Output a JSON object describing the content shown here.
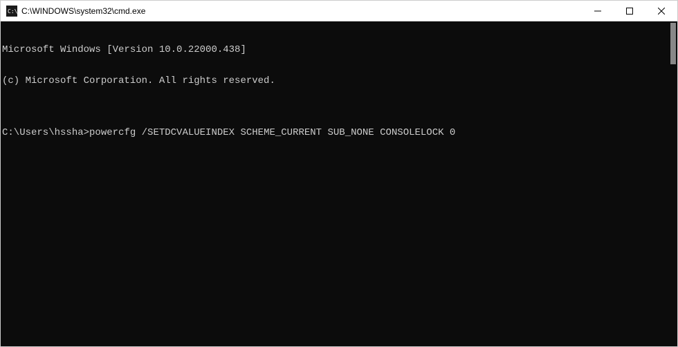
{
  "window": {
    "title": "C:\\WINDOWS\\system32\\cmd.exe"
  },
  "terminal": {
    "line1": "Microsoft Windows [Version 10.0.22000.438]",
    "line2": "(c) Microsoft Corporation. All rights reserved.",
    "blank": "",
    "prompt": "C:\\Users\\hssha>",
    "command": "powercfg /SETDCVALUEINDEX SCHEME_CURRENT SUB_NONE CONSOLELOCK 0"
  }
}
